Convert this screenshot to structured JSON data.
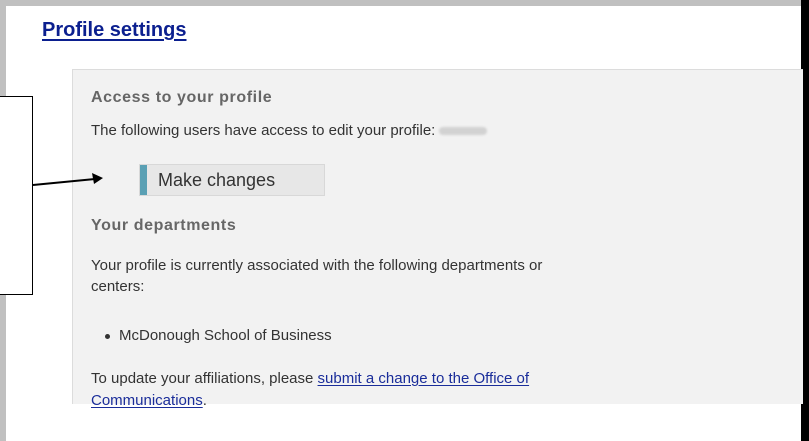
{
  "page": {
    "title": "Profile settings"
  },
  "access": {
    "heading": "Access to your profile",
    "description": "The following users have access to edit your profile:",
    "make_changes_label": "Make changes"
  },
  "departments": {
    "heading": "Your departments",
    "description_line1": "Your profile is currently associated with the following departments or",
    "description_line2": "centers:",
    "items": [
      "McDonough School of Business"
    ],
    "update_prefix": "To update your affiliations, please",
    "update_link_line1": "submit a change to the Office of",
    "update_link_line2": "Communications",
    "update_suffix": "."
  },
  "colors": {
    "title_blue": "#0b1f8f",
    "link_blue": "#1a2d9a",
    "panel_gray": "#f2f2f2",
    "button_accent": "#5aa0b4"
  }
}
